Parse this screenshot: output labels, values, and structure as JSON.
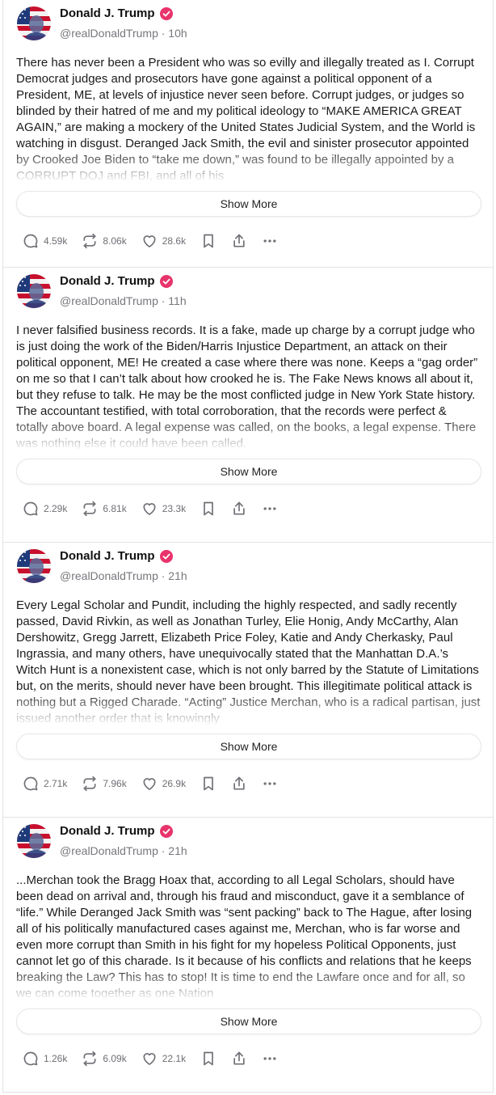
{
  "posts": [
    {
      "name": "Donald J. Trump",
      "handle": "@realDonaldTrump · 10h",
      "body": "There has never been a President who was so evilly and illegally treated as I. Corrupt Democrat judges and prosecutors have gone against a political opponent of a President, ME, at levels of injustice never seen before. Corrupt judges, or judges so blinded by their hatred of me and my political ideology to “MAKE AMERICA GREAT AGAIN,” are making a mockery of the United States Judicial System, and the World is watching in disgust. Deranged Jack Smith, the evil and sinister prosecutor appointed by Crooked Joe Biden to “take me down,” was found to be illegally appointed by a CORRUPT DOJ and FBI, and all of his",
      "show_more": "Show More",
      "replies": "4.59k",
      "retruths": "8.06k",
      "likes": "28.6k"
    },
    {
      "name": "Donald J. Trump",
      "handle": "@realDonaldTrump · 11h",
      "body": "I never falsified business records. It is a fake, made up charge by a corrupt judge who is just doing the work of the Biden/Harris Injustice Department, an attack on their political opponent, ME! He created a case where there was none. Keeps a “gag order” on me so that I can’t talk about how crooked he is. The Fake News knows all about it, but they refuse to talk. He may be the most conflicted judge in New York State history. The accountant testified, with total corroboration, that the records were perfect & totally above board. A legal expense was called, on the books, a legal expense. There was nothing else it could have been called.",
      "show_more": "Show More",
      "replies": "2.29k",
      "retruths": "6.81k",
      "likes": "23.3k"
    },
    {
      "name": "Donald J. Trump",
      "handle": "@realDonaldTrump · 21h",
      "body": "Every Legal Scholar and Pundit, including the highly respected, and sadly recently passed, David Rivkin, as well as Jonathan Turley, Elie Honig, Andy McCarthy, Alan Dershowitz, Gregg Jarrett, Elizabeth Price Foley, Katie and Andy Cherkasky, Paul Ingrassia, and many others, have unequivocally stated that the Manhattan D.A.’s Witch Hunt is a nonexistent case, which is not only barred by the Statute of Limitations but, on the merits, should never have been brought. This illegitimate political attack is nothing but a Rigged Charade. “Acting” Justice Merchan, who is a radical partisan, just issued another order that is knowingly",
      "show_more": "Show More",
      "replies": "2.71k",
      "retruths": "7.96k",
      "likes": "26.9k"
    },
    {
      "name": "Donald J. Trump",
      "handle": "@realDonaldTrump · 21h",
      "body": "...Merchan took the Bragg Hoax that, according to all Legal Scholars, should have been dead on arrival and, through his fraud and misconduct, gave it a semblance of “life.” While Deranged Jack Smith was “sent packing” back to The Hague, after losing all of his politically manufactured cases against me, Merchan, who is far worse and even more corrupt than Smith in his fight for my hopeless Political Opponents, just cannot let go of this charade. Is it because of his conflicts and relations that he keeps breaking the Law? This has to stop! It is time to end the Lawfare once and for all, so we can come together as one Nation",
      "show_more": "Show More",
      "replies": "1.26k",
      "retruths": "6.09k",
      "likes": "22.1k"
    }
  ],
  "colors": {
    "verified": "#e8336b",
    "icon": "#6f6f75",
    "border": "#e3e3e6"
  },
  "icons": {
    "reply": "chat-bubble-icon",
    "retruth": "repost-arrows-icon",
    "like": "heart-icon",
    "bookmark": "bookmark-icon",
    "share": "share-upload-icon",
    "more": "ellipsis-icon"
  }
}
